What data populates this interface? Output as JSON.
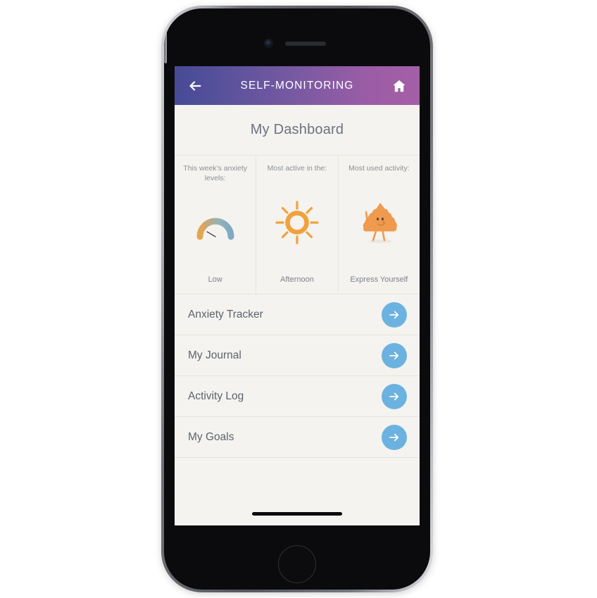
{
  "app_bar": {
    "title": "SELF-MONITORING",
    "back_icon": "arrow-left-icon",
    "home_icon": "home-icon",
    "gradient_start": "#474a96",
    "gradient_end": "#a45fa6"
  },
  "page": {
    "title": "My Dashboard",
    "background": "#f4f3ef"
  },
  "stat_cards": [
    {
      "label": "This week's anxiety levels:",
      "value": "Low",
      "icon": "gauge-icon",
      "icon_colors": [
        "#e8a54e",
        "#8fb6b8",
        "#7fa9c4"
      ]
    },
    {
      "label": "Most active in the:",
      "value": "Afternoon",
      "icon": "sun-icon",
      "icon_colors": [
        "#f0a23c"
      ]
    },
    {
      "label": "Most used activity:",
      "value": "Express Yourself",
      "icon": "orange-blob-character-icon",
      "icon_colors": [
        "#ef9a4e"
      ]
    }
  ],
  "menu_items": [
    {
      "label": "Anxiety Tracker",
      "action_icon": "arrow-right-icon"
    },
    {
      "label": "My Journal",
      "action_icon": "arrow-right-icon"
    },
    {
      "label": "Activity Log",
      "action_icon": "arrow-right-icon"
    },
    {
      "label": "My Goals",
      "action_icon": "arrow-right-icon"
    }
  ],
  "theme": {
    "accent_blue": "#6cb2e0",
    "text_gray": "#5c636d",
    "muted_gray": "#8b8f96",
    "divider": "#e6e4dd"
  }
}
